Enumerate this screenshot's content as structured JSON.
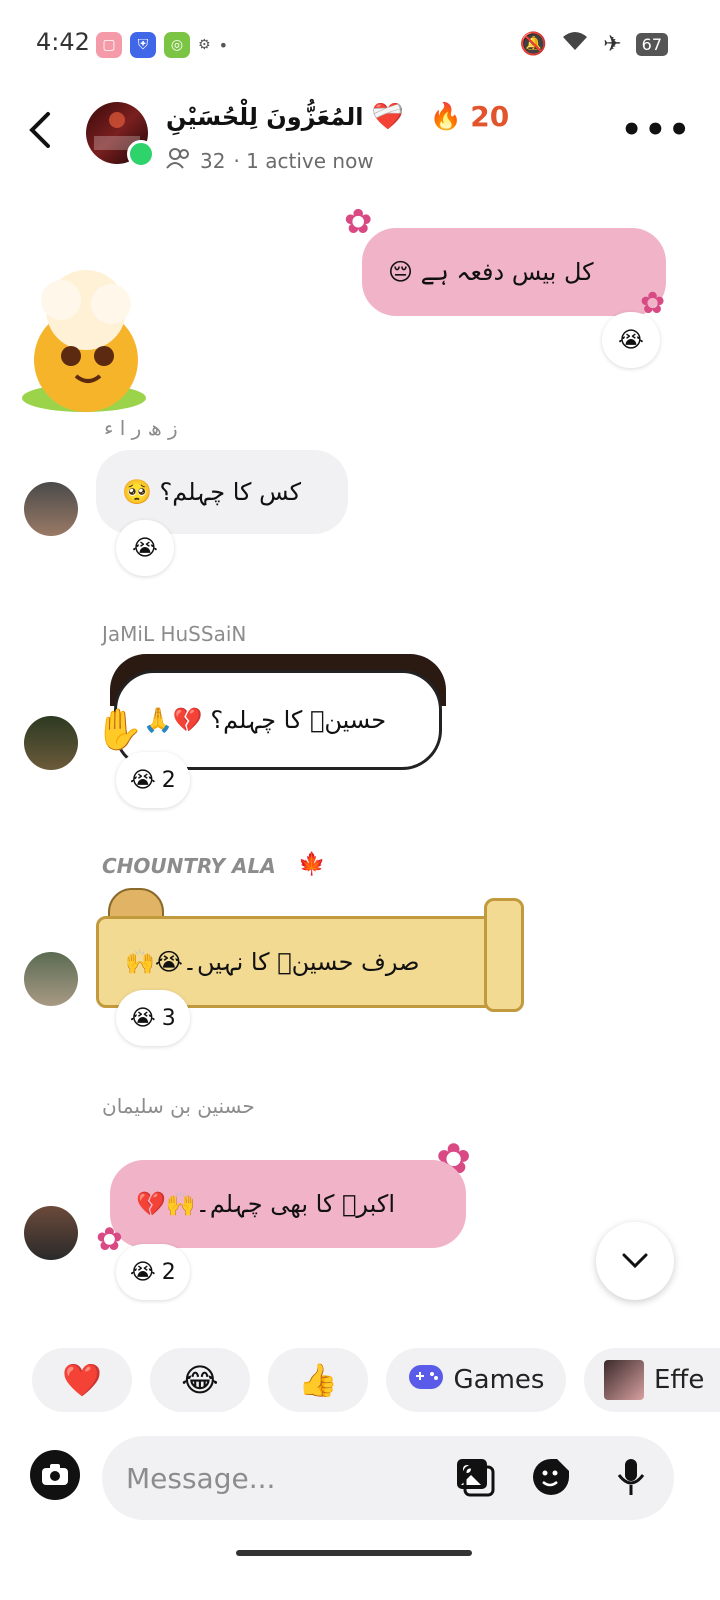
{
  "status": {
    "time": "4:42",
    "battery": "67"
  },
  "header": {
    "title": "المُعَزُّونَ لِلْحُسَیْنِ",
    "heart": "❤️‍🩹",
    "streak_count": "20",
    "members": "32",
    "active": "· 1 active now"
  },
  "messages": {
    "m1": {
      "text": "کل بیس دفعہ ہے 😔",
      "reaction": "😭"
    },
    "m2": {
      "sender": "ز ھ ر ا ء",
      "text": "کس کا چہلم؟ 🥺",
      "reaction": "😭"
    },
    "m3": {
      "sender": "JaMiL HuSSaiN",
      "text": "حسینؑ کا چہلم؟ 💔🙏",
      "reaction": "😭",
      "reaction_count": "2"
    },
    "m4": {
      "sender": "CHOUNTRY ALA",
      "sender_icon": "🍁",
      "text": "صرف حسینؑ کا نہیں۔😭🙌",
      "reaction": "😭",
      "reaction_count": "3"
    },
    "m5": {
      "sender": "حسنین بن سلیمان",
      "text": "اکبرؑ کا بھی چہلم۔🙌💔",
      "reaction": "😭",
      "reaction_count": "2"
    }
  },
  "quick_reactions": {
    "heart": "❤️",
    "laugh": "😂",
    "thumbs": "👍",
    "games": "Games",
    "effects": "Effe"
  },
  "composer": {
    "placeholder": "Message..."
  },
  "colors": {
    "pink_bubble": "#f1b3c8",
    "grey_bubble": "#f1f1f3",
    "streak": "#e2542c"
  }
}
